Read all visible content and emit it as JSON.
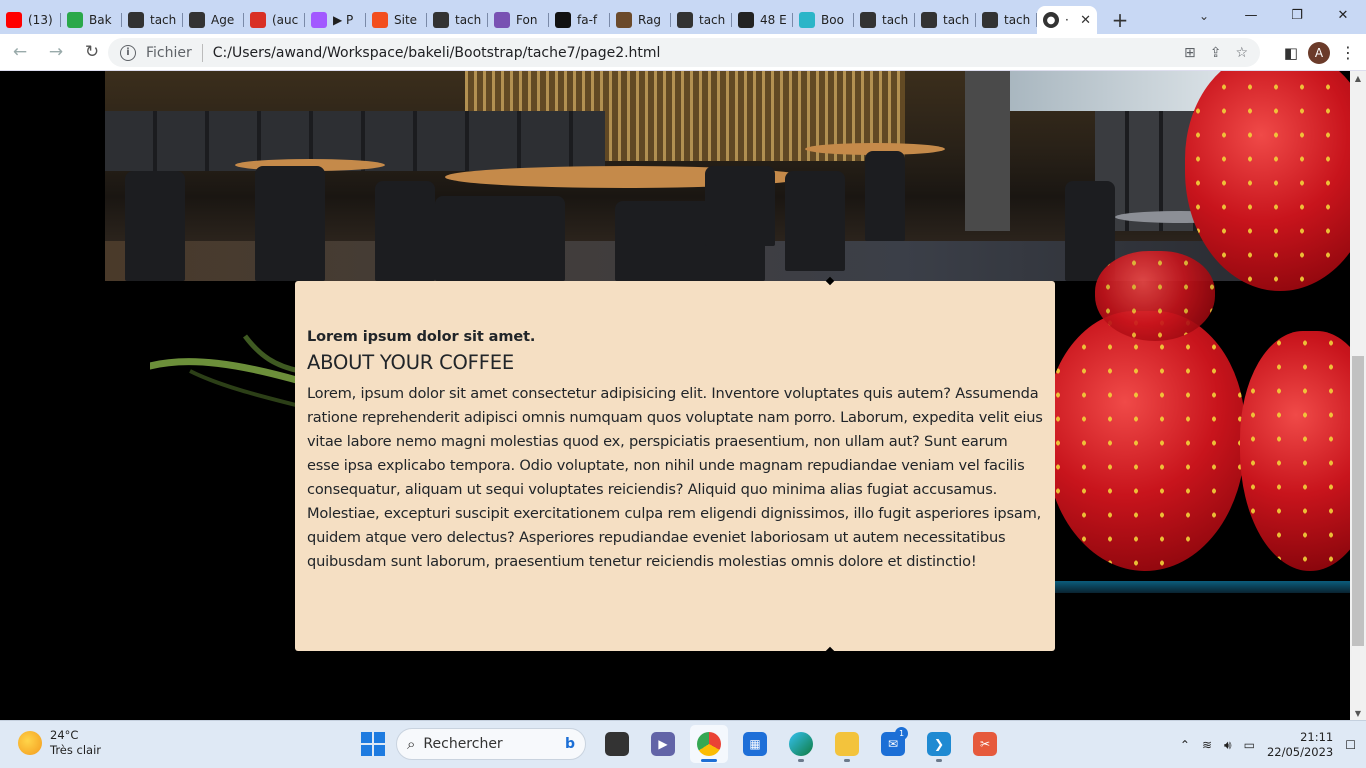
{
  "browser": {
    "tabs": [
      {
        "label": "(13)",
        "icon": "youtube-icon",
        "color": "#ff0000"
      },
      {
        "label": "Bak",
        "icon": "bakeli-icon",
        "color": "#2aa84a"
      },
      {
        "label": "tach",
        "icon": "globe-icon",
        "color": "#333333"
      },
      {
        "label": "Age",
        "icon": "www-icon",
        "color": "#333333"
      },
      {
        "label": "(auc",
        "icon": "gmail-icon",
        "color": "#d93025"
      },
      {
        "label": "▶ P",
        "icon": "figma-icon",
        "color": "#a259ff"
      },
      {
        "label": "Site",
        "icon": "figma-icon",
        "color": "#f24e1e"
      },
      {
        "label": "tach",
        "icon": "globe-icon",
        "color": "#333333"
      },
      {
        "label": "Fon",
        "icon": "bootstrap-icon",
        "color": "#7952b3"
      },
      {
        "label": "fa-f",
        "icon": "fontawesome-icon",
        "color": "#111111"
      },
      {
        "label": "Rag",
        "icon": "image-icon",
        "color": "#6b4a2b"
      },
      {
        "label": "tach",
        "icon": "globe-icon",
        "color": "#333333"
      },
      {
        "label": "48 E",
        "icon": "f-icon",
        "color": "#222222"
      },
      {
        "label": "Boo",
        "icon": "bd-icon",
        "color": "#2bb5c8"
      },
      {
        "label": "tach",
        "icon": "globe-icon",
        "color": "#333333"
      },
      {
        "label": "tach",
        "icon": "globe-icon",
        "color": "#333333"
      },
      {
        "label": "tach",
        "icon": "globe-icon",
        "color": "#333333"
      }
    ],
    "active_tab": {
      "label": "·",
      "icon": "globe-icon"
    },
    "address": {
      "scheme_label": "Fichier",
      "url": "C:/Users/awand/Workspace/bakeli/Bootstrap/tache7/page2.html"
    },
    "profile_initial": "A"
  },
  "page": {
    "card": {
      "subtitle": "Lorem ipsum dolor sit amet.",
      "heading": "ABOUT YOUR COFFEE",
      "body": "Lorem, ipsum dolor sit amet consectetur adipisicing elit. Inventore voluptates quis autem? Assumenda ratione reprehenderit adipisci omnis numquam quos voluptate nam porro. Laborum, expedita velit eius vitae labore nemo magni molestias quod ex, perspiciatis praesentium, non ullam aut? Sunt earum esse ipsa explicabo tempora. Odio voluptate, non nihil unde magnam repudiandae veniam vel facilis consequatur, aliquam ut sequi voluptates reiciendis? Aliquid quo minima alias fugiat accusamus. Molestiae, excepturi suscipit exercitationem culpa rem eligendi dignissimos, illo fugit asperiores ipsam, quidem atque vero delectus? Asperiores repudiandae eveniet laboriosam ut autem necessitatibus quibusdam sunt laborum, praesentium tenetur reiciendis molestias omnis dolore et distinctio!",
      "background": "#f5dfc3"
    }
  },
  "taskbar": {
    "weather": {
      "temp": "24°C",
      "desc": "Très clair"
    },
    "search_placeholder": "Rechercher",
    "mail_badge": "1",
    "time": "21:11",
    "date": "22/05/2023"
  }
}
